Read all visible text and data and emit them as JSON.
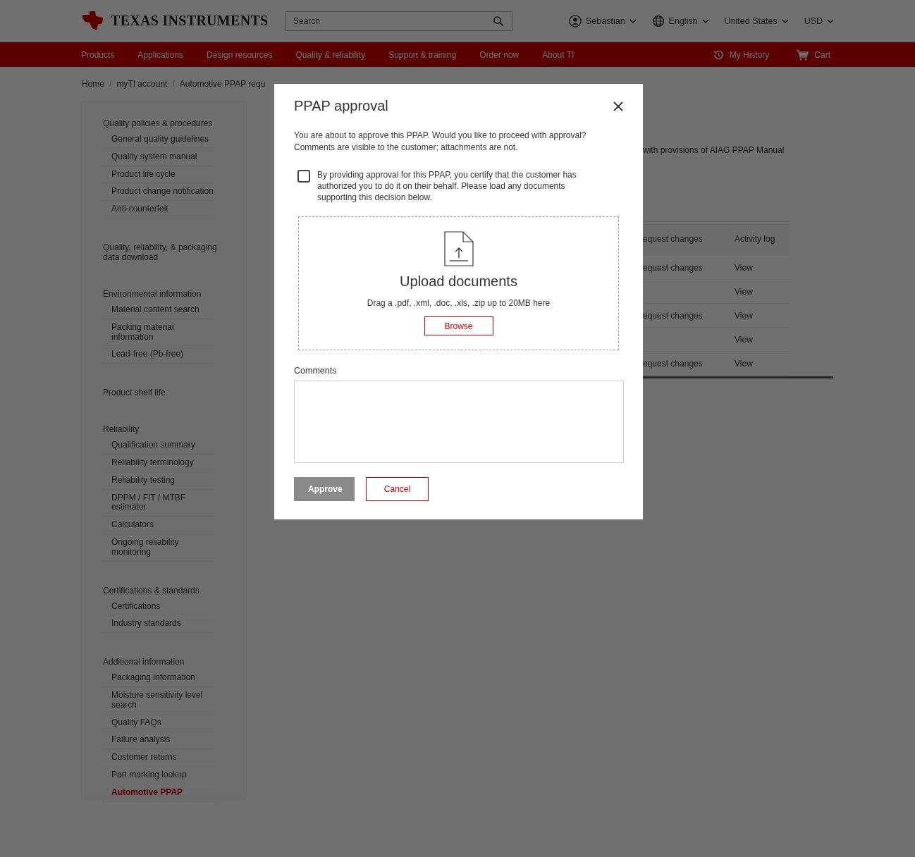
{
  "header": {
    "logo": "TEXAS INSTRUMENTS",
    "search": {
      "placeholder": "Search"
    },
    "user": "Sebastian",
    "language": "English",
    "region": "United States",
    "currency": "USD"
  },
  "nav": {
    "items": [
      "Products",
      "Applications",
      "Design resources",
      "Quality & reliability",
      "Support & training",
      "Order now",
      "About TI"
    ],
    "history": "My History",
    "cart": "Cart"
  },
  "breadcrumb": {
    "separator": "/",
    "items": [
      "Home",
      "myTI account",
      "Automotive PPAP requ"
    ]
  },
  "sidebar": [
    {
      "label": "Quality policies & procedures",
      "selected": false,
      "children": [
        {
          "label": "General quality guidelines",
          "selected": false
        },
        {
          "label": "Quality system manual",
          "selected": false
        },
        {
          "label": "Product life cycle",
          "selected": false
        },
        {
          "label": "Product change notification",
          "selected": false
        },
        {
          "label": "Anti-counterfeit",
          "selected": false
        }
      ]
    },
    {
      "label": "Quality, reliability, & packaging data download",
      "selected": false
    },
    {
      "label": "Environmental information",
      "selected": false,
      "children": [
        {
          "label": "Material content search",
          "selected": false
        },
        {
          "label": "Packing material information",
          "selected": false
        },
        {
          "label": "Lead-free (Pb-free)",
          "selected": false
        }
      ]
    },
    {
      "label": "Product shelf life",
      "selected": false
    },
    {
      "label": "Reliability",
      "selected": false,
      "children": [
        {
          "label": "Qualification summary",
          "selected": false
        },
        {
          "label": "Reliability terminology",
          "selected": false
        },
        {
          "label": "Reliability testing",
          "selected": false
        },
        {
          "label": "DPPM / FIT / MTBF estimator",
          "selected": false
        },
        {
          "label": "Calculators",
          "selected": false
        },
        {
          "label": "Ongoing reliability monitoring",
          "selected": false
        }
      ]
    },
    {
      "label": "Certifications & standards",
      "selected": false,
      "children": [
        {
          "label": "Certifications",
          "selected": false
        },
        {
          "label": "Industry standards",
          "selected": false
        }
      ]
    },
    {
      "label": "Additional information",
      "selected": false,
      "children": [
        {
          "label": "Packaging information",
          "selected": false
        },
        {
          "label": "Moisture sensitivity level search",
          "selected": false
        },
        {
          "label": "Quality FAQs",
          "selected": false
        },
        {
          "label": "Failure analysis",
          "selected": false
        },
        {
          "label": "Customer returns",
          "selected": false
        },
        {
          "label": "Part marking lookup",
          "selected": false
        },
        {
          "label": "Automotive PPAP",
          "selected": true
        }
      ]
    }
  ],
  "main": {
    "intro_fragment": "with provisions of AIAG PPAP Manual",
    "table": {
      "columns": [
        "equest changes",
        "Activity log"
      ],
      "rows": [
        {
          "column_1": "equest changes",
          "activity_log": "View"
        },
        {
          "activity_log": "View"
        },
        {
          "column_1": "equest changes",
          "activity_log": "View"
        },
        {
          "activity_log": "View"
        },
        {
          "column_1": "equest changes",
          "activity_log": "View"
        }
      ]
    }
  },
  "dialog": {
    "title": "PPAP approval",
    "message": "You are about to approve this PPAP. Would you like to proceed with approval? Comments are visible to the customer; attachments are not.",
    "certify": {
      "label": "By providing approval for this PPAP, you certify that the customer has authorized you to do it on their behalf. Please load any documents supporting this decision below.",
      "checked": false
    },
    "upload": {
      "title": "Upload documents",
      "hint": "Drag a .pdf, .xml, .doc, .xls, .zip up to 20MB here",
      "button": "Browse"
    },
    "comments_label": "Comments",
    "buttons": [
      {
        "label": "Approve",
        "kind": "primary",
        "disabled": true
      },
      {
        "label": "Cancel",
        "kind": "secondary",
        "disabled": false
      }
    ]
  }
}
